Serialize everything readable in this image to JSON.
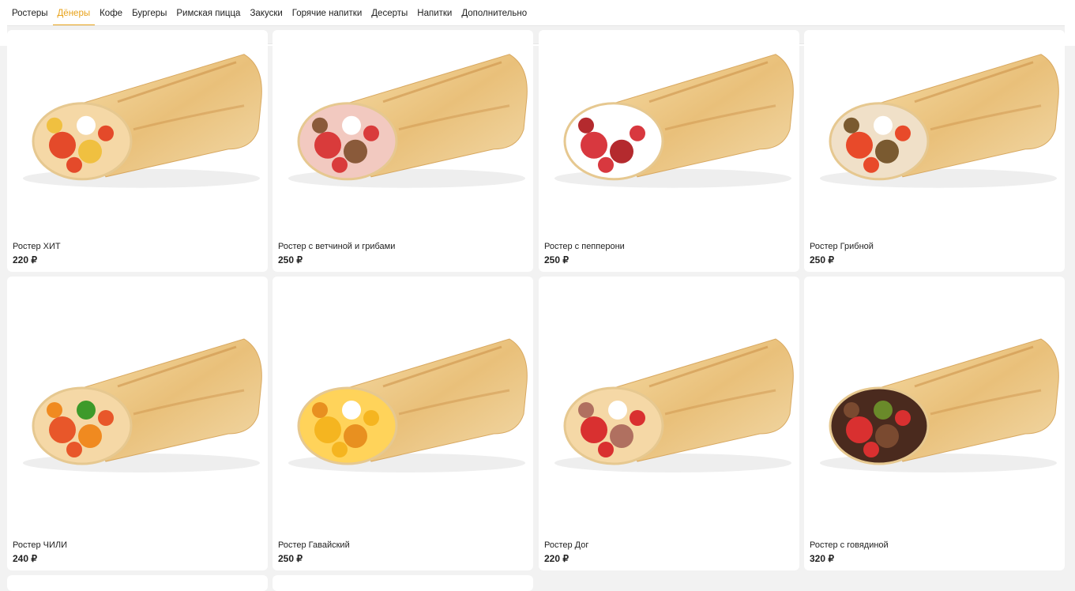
{
  "nav": {
    "tabs": [
      {
        "label": "Ростеры"
      },
      {
        "label": "Дёнеры",
        "active": true
      },
      {
        "label": "Кофе"
      },
      {
        "label": "Бургеры"
      },
      {
        "label": "Римская пицца"
      },
      {
        "label": "Закуски"
      },
      {
        "label": "Горячие напитки"
      },
      {
        "label": "Десерты"
      },
      {
        "label": "Напитки"
      },
      {
        "label": "Дополнительно"
      }
    ],
    "active_color": "#e8a21a"
  },
  "products": [
    {
      "name": "Ростер ХИТ",
      "price": "220 ₽",
      "filling": "chicken"
    },
    {
      "name": "Ростер с ветчиной и грибами",
      "price": "250 ₽",
      "filling": "ham"
    },
    {
      "name": "Ростер с пепперони",
      "price": "250 ₽",
      "filling": "pepperoni"
    },
    {
      "name": "Ростер Грибной",
      "price": "250 ₽",
      "filling": "mushroom"
    },
    {
      "name": "Ростер ЧИЛИ",
      "price": "240 ₽",
      "filling": "chili"
    },
    {
      "name": "Ростер Гавайский",
      "price": "250 ₽",
      "filling": "pineapple"
    },
    {
      "name": "Ростер Дог",
      "price": "220 ₽",
      "filling": "sausage"
    },
    {
      "name": "Ростер с говядиной",
      "price": "320 ₽",
      "filling": "beef"
    }
  ]
}
